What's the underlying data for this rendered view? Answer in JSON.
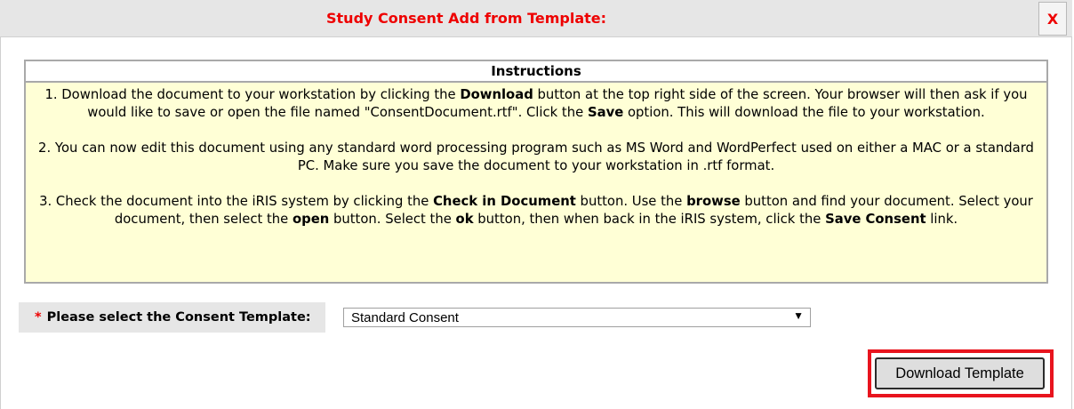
{
  "dialog": {
    "title": "Study Consent Add from Template:",
    "close_label": "X"
  },
  "instructions": {
    "header": "Instructions",
    "step1": {
      "t1": "1. Download the document to your workstation by clicking the ",
      "b1": "Download",
      "t2": " button at the top right side of the screen. Your browser will then ask if you would like to save or open the file named \"ConsentDocument.rtf\". Click the ",
      "b2": "Save",
      "t3": " option. This will download the file to your workstation."
    },
    "step2": "2. You can now edit this document using any standard word processing program such as MS Word and WordPerfect used on either a MAC or a standard PC. Make sure you save the document to your workstation in .rtf format.",
    "step3": {
      "t1": "3. Check the document into the iRIS system by clicking the ",
      "b1": "Check in Document",
      "t2": " button. Use the ",
      "b2": "browse",
      "t3": " button and find your document. Select your document, then select the ",
      "b3": "open",
      "t4": " button. Select the ",
      "b4": "ok",
      "t5": " button, then when back in the iRIS system, click the ",
      "b5": "Save Consent",
      "t6": " link."
    }
  },
  "template_select": {
    "required_marker": "*",
    "label": "Please select the Consent Template:",
    "selected": "Standard Consent",
    "arrow_icon": "▼"
  },
  "actions": {
    "download_label": "Download Template"
  },
  "colors": {
    "title": "#ee0000",
    "instructions_bg": "#ffffd6",
    "highlight": "#e8141e"
  }
}
